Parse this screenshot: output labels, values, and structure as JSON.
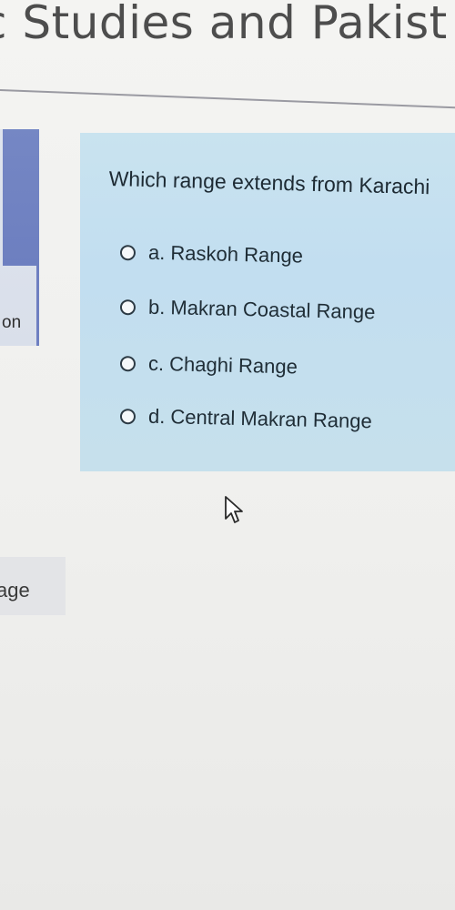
{
  "header": {
    "title": "c Studies and Pakist"
  },
  "sidebar": {
    "label": "on"
  },
  "quiz": {
    "question": "Which range extends from Karachi",
    "options": [
      {
        "label": "a. Raskoh Range",
        "selected": false
      },
      {
        "label": "b. Makran Coastal Range",
        "selected": false
      },
      {
        "label": "c. Chaghi Range",
        "selected": false
      },
      {
        "label": "d. Central Makran Range",
        "selected": false
      }
    ]
  },
  "footer": {
    "page_button_label": "age"
  },
  "colors": {
    "card_background": "#c6e0ec",
    "nav_accent": "#6e7fc1"
  }
}
